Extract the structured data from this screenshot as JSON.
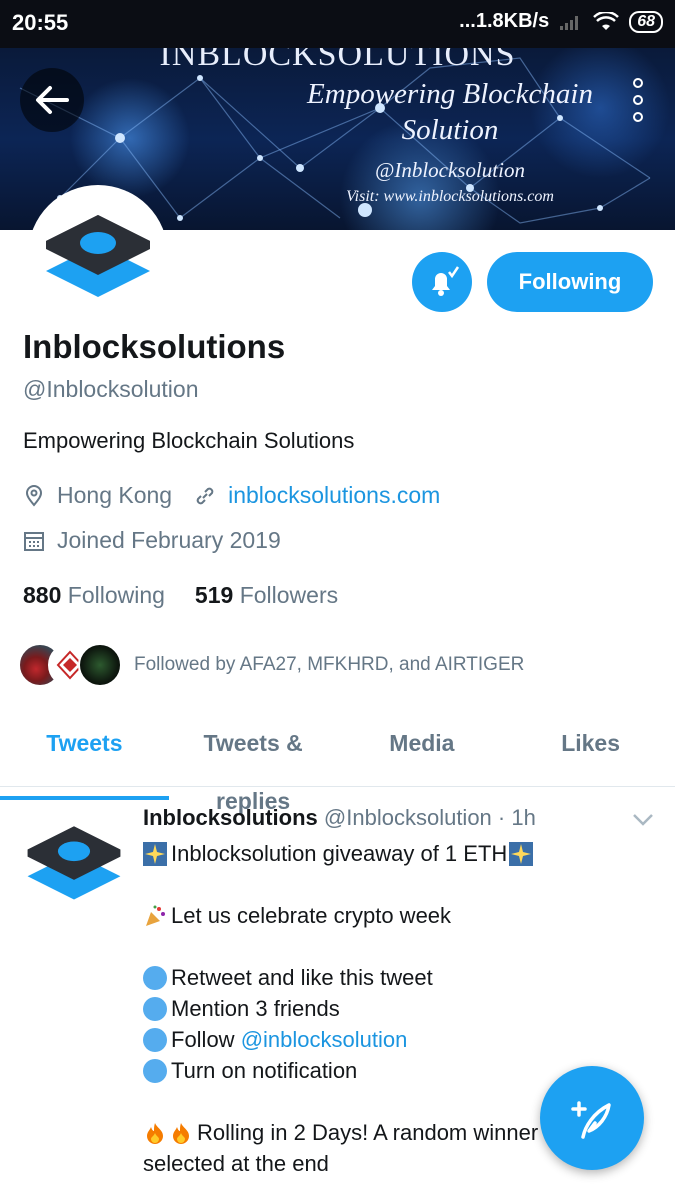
{
  "statusbar": {
    "time": "20:55",
    "network_speed": "...1.8KB/s",
    "battery": "68"
  },
  "banner": {
    "title": "INBLOCKSOLUTIONS",
    "tagline_1": "Empowering Blockchain",
    "tagline_2": "Solution",
    "handle": "@Inblocksolution",
    "visit": "Visit: www.inblocksolutions.com"
  },
  "profile": {
    "name": "Inblocksolutions",
    "handle": "@Inblocksolution",
    "bio": "Empowering Blockchain Solutions",
    "location": "Hong Kong",
    "website": "inblocksolutions.com",
    "joined": "Joined February 2019",
    "following_count": "880",
    "following_label": "Following",
    "followers_count": "519",
    "followers_label": "Followers",
    "followed_by": "Followed by AFA27, MFKHRD, and AIRTIGER",
    "follow_button_label": "Following"
  },
  "tabs": [
    {
      "label": "Tweets",
      "active": true
    },
    {
      "label": "Tweets & replies",
      "active": false
    },
    {
      "label": "Media",
      "active": false
    },
    {
      "label": "Likes",
      "active": false
    }
  ],
  "tweet": {
    "author": "Inblocksolutions",
    "handle": "@Inblocksolution",
    "time": "· 1h",
    "lines": {
      "l1": "Inblocksolution giveaway of 1 ETH",
      "l2": "Let us celebrate crypto week",
      "l3": "Retweet and like this tweet",
      "l4": "Mention 3 friends",
      "l5_prefix": "Follow ",
      "l5_mention": "@inblocksolution",
      "l6": "Turn on notification",
      "l7": "Rolling in 2 Days! A random winner",
      "l8": "selected at the end"
    }
  },
  "icons": {
    "back": "arrow-left-icon",
    "more": "more-vertical-icon",
    "bell": "bell-icon",
    "location": "location-pin-icon",
    "link": "link-icon",
    "calendar": "calendar-icon",
    "compose": "compose-tweet-icon"
  },
  "colors": {
    "accent": "#1da1f2",
    "secondary_text": "#657786",
    "link": "#1b95e0"
  }
}
